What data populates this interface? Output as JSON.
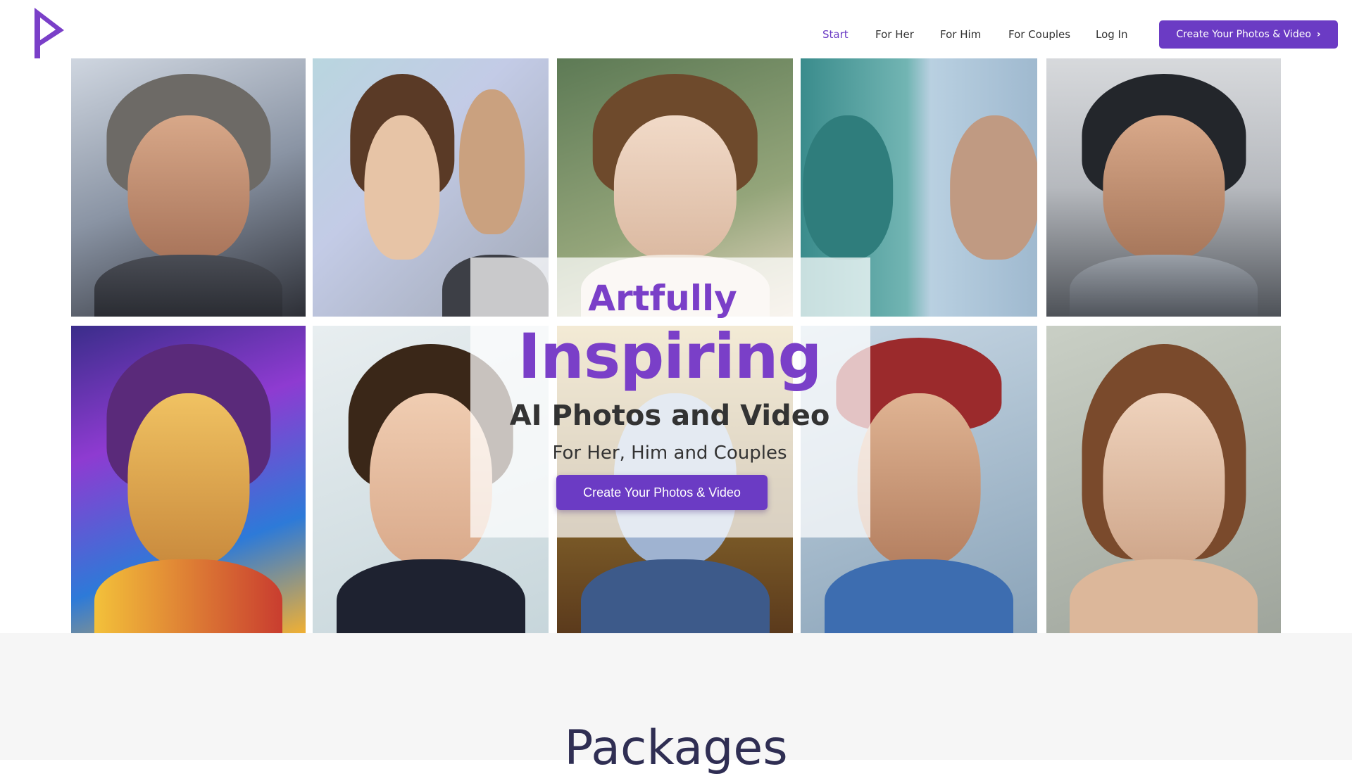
{
  "brand": {
    "logo_icon": "p-play-logo-icon",
    "accent_color": "#6b3bc4"
  },
  "nav": {
    "items": [
      {
        "label": "Start",
        "active": true
      },
      {
        "label": "For Her",
        "active": false
      },
      {
        "label": "For Him",
        "active": false
      },
      {
        "label": "For Couples",
        "active": false
      },
      {
        "label": "Log In",
        "active": false
      }
    ],
    "cta_label": "Create Your Photos & Video",
    "cta_icon": "chevron-right-icon"
  },
  "gallery": {
    "tiles": [
      {
        "subject": "bearded-warrior-portrait"
      },
      {
        "subject": "couple-portrait"
      },
      {
        "subject": "woman-with-flowers-portrait"
      },
      {
        "subject": "mosaic-faces-portrait"
      },
      {
        "subject": "armored-hero-portrait"
      },
      {
        "subject": "cosmic-heroine-portrait"
      },
      {
        "subject": "curly-haired-man-portrait"
      },
      {
        "subject": "fantasy-portrait"
      },
      {
        "subject": "baseball-player-portrait"
      },
      {
        "subject": "elf-woman-portrait"
      }
    ]
  },
  "hero": {
    "line1": "Artfully",
    "line2": "Inspiring",
    "line3": "AI Photos and Video",
    "line4": "For Her, Him and Couples",
    "cta_label": "Create Your Photos & Video"
  },
  "packages": {
    "title": "Packages"
  }
}
